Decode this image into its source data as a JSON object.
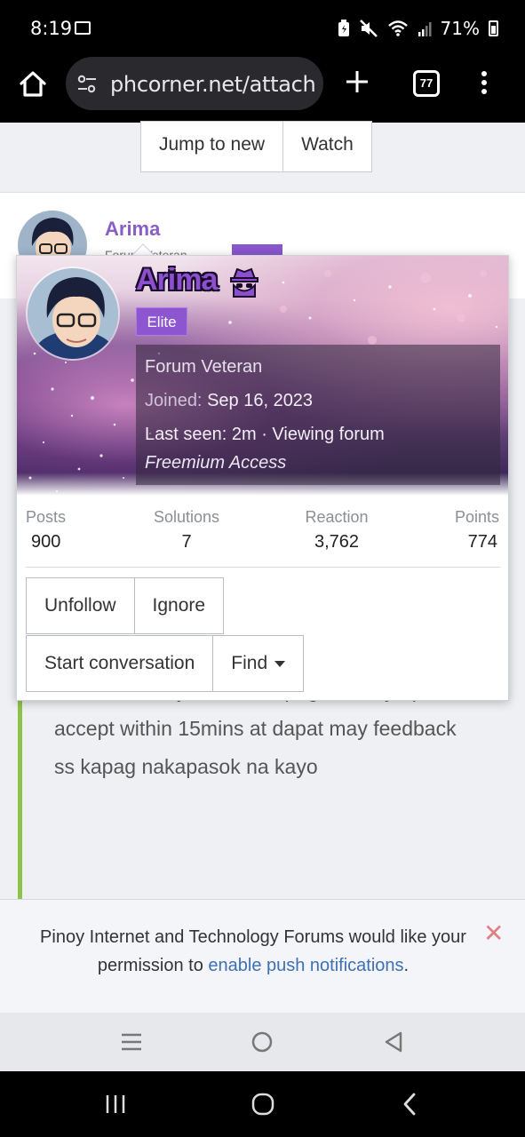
{
  "status_bar": {
    "time": "8:19",
    "battery": "71%",
    "icons": [
      "image-icon",
      "battery-saver-icon",
      "mute-icon",
      "wifi-icon",
      "signal-icon",
      "battery-icon"
    ]
  },
  "browser": {
    "url": "phcorner.net/attachr",
    "tab_count": "77",
    "icons": [
      "home-icon",
      "site-settings-icon",
      "new-tab-icon",
      "tabs-icon",
      "more-menu-icon"
    ]
  },
  "toolbar": {
    "jump_label": "Jump to new",
    "watch_label": "Watch"
  },
  "post": {
    "author": "Arima",
    "sub_title": "Forum Veteran",
    "text": "remove ko kayo sa inv kapag hindi nyo pa na accept within 15mins at dapat may feedback ss kapag nakapasok na kayo"
  },
  "card": {
    "name": "Arima",
    "badge": "Elite",
    "title": "Forum Veteran",
    "joined_label": "Joined:",
    "joined_date": "Sep 16, 2023",
    "last_seen_label": "Last seen:",
    "last_seen_value": "2m · Viewing forum",
    "access": "Freemium Access",
    "stats": [
      {
        "label": "Posts",
        "value": "900"
      },
      {
        "label": "Solutions",
        "value": "7"
      },
      {
        "label": "Reaction",
        "value": "3,762"
      },
      {
        "label": "Points",
        "value": "774"
      }
    ],
    "buttons": {
      "unfollow": "Unfollow",
      "ignore": "Ignore",
      "start_conversation": "Start conversation",
      "find": "Find"
    }
  },
  "notice": {
    "text_before": "Pinoy Internet and Technology Forums would like your permission to ",
    "link": "enable push notifications",
    "text_after": ".",
    "close": "✕"
  },
  "colors": {
    "accent_purple": "#8b5ec7",
    "badge_purple": "#8e55d0",
    "link_blue": "#3f6fb5",
    "post_border_green": "#8fc24a"
  }
}
